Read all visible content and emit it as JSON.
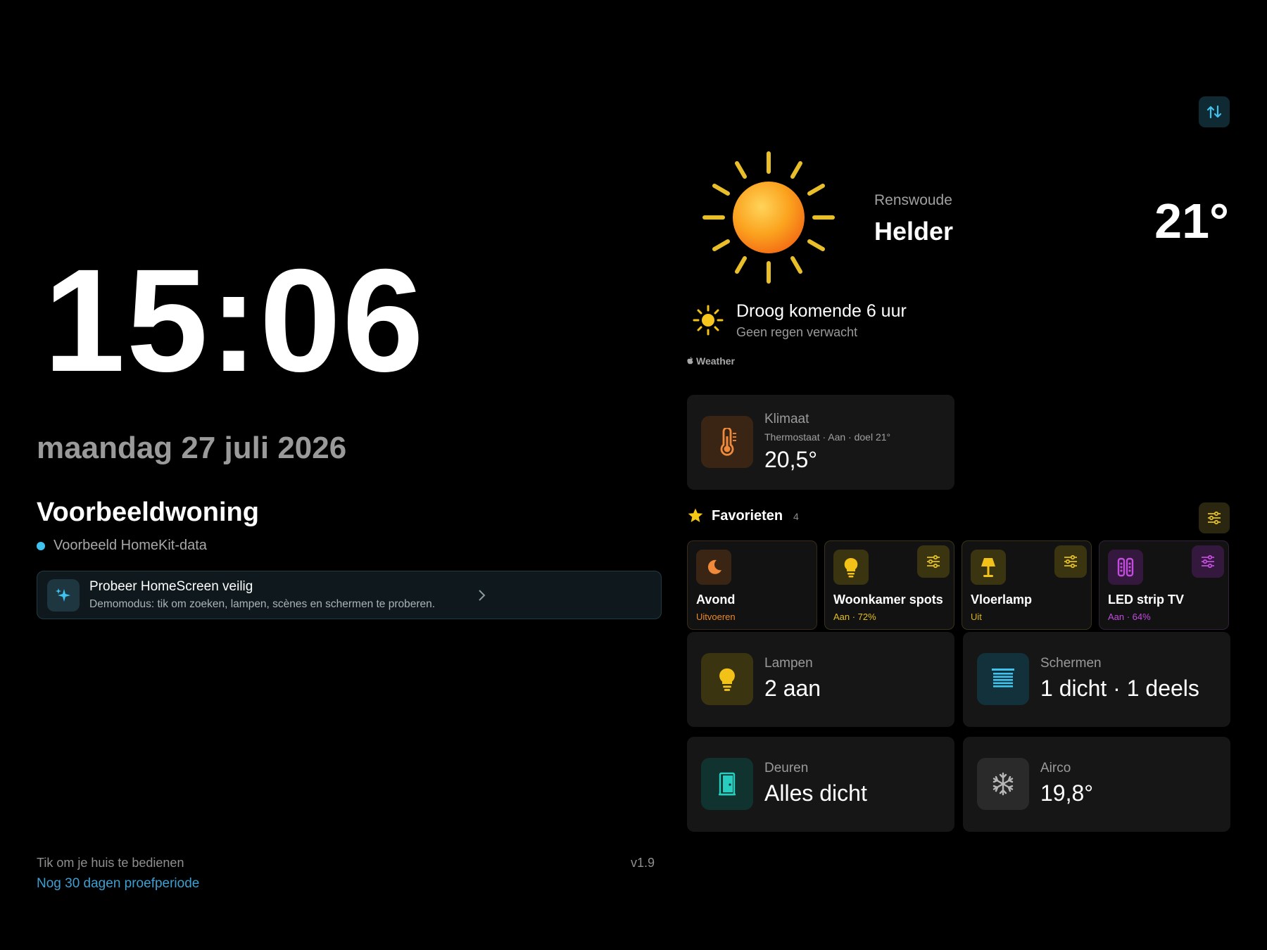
{
  "clock": {
    "time": "15:06",
    "date": "maandag 27 juli 2026"
  },
  "home": {
    "name": "Voorbeeldwoning",
    "source": "Voorbeeld HomeKit-data"
  },
  "demo_banner": {
    "title": "Probeer HomeScreen veilig",
    "description": "Demomodus: tik om zoeken, lampen, scènes en schermen te proberen."
  },
  "footer": {
    "hint": "Tik om je huis te bedienen",
    "trial": "Nog 30 dagen proefperiode",
    "version": "v1.9"
  },
  "weather": {
    "location": "Renswoude",
    "condition": "Helder",
    "temperature": "21°",
    "forecast_title": "Droog komende 6 uur",
    "forecast_sub": "Geen regen verwacht",
    "source": "Weather"
  },
  "climate": {
    "label": "Klimaat",
    "detail": "Thermostaat · Aan · doel 21°",
    "value": "20,5°"
  },
  "favorites": {
    "title": "Favorieten",
    "count": "4",
    "items": [
      {
        "name": "Avond",
        "state": "Uitvoeren",
        "state_color": "#e8892c",
        "icon": "moon-icon"
      },
      {
        "name": "Woonkamer spots",
        "state": "Aan · 72%",
        "state_color": "#e3bf1d",
        "icon": "lightbulb-icon"
      },
      {
        "name": "Vloerlamp",
        "state": "Uit",
        "state_color": "#d5b21c",
        "icon": "floor-lamp-icon"
      },
      {
        "name": "LED strip TV",
        "state": "Aan · 64%",
        "state_color": "#c44be0",
        "icon": "led-strip-icon"
      }
    ]
  },
  "summary": {
    "lampen": {
      "label": "Lampen",
      "value": "2 aan"
    },
    "schermen": {
      "label": "Schermen",
      "value": "1 dicht · 1 deels"
    },
    "deuren": {
      "label": "Deuren",
      "value": "Alles dicht"
    },
    "airco": {
      "label": "Airco",
      "value": "19,8°"
    }
  },
  "colors": {
    "accent_blue": "#3fc2ee",
    "trial_link": "#3e9fd2",
    "sun": "#f7941d"
  }
}
